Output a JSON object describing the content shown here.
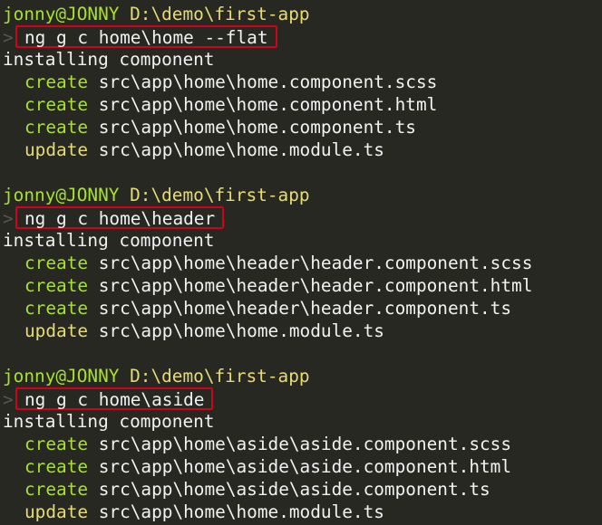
{
  "colors": {
    "background": "#272822",
    "user_host": "#a6e22e",
    "cwd": "#e6db74",
    "create": "#a6e22e",
    "update": "#e6db74",
    "text": "#f2f2f2",
    "highlight_box": "#d0021b"
  },
  "blocks": [
    {
      "user_host": "jonny@JONNY",
      "cwd": "D:\\demo\\first-app",
      "prompt_symbol": ">",
      "command": "ng g c home\\home --flat",
      "status": "installing component",
      "actions": [
        {
          "action": "create",
          "path": "src\\app\\home\\home.component.scss"
        },
        {
          "action": "create",
          "path": "src\\app\\home\\home.component.html"
        },
        {
          "action": "create",
          "path": "src\\app\\home\\home.component.ts"
        },
        {
          "action": "update",
          "path": "src\\app\\home\\home.module.ts"
        }
      ]
    },
    {
      "user_host": "jonny@JONNY",
      "cwd": "D:\\demo\\first-app",
      "prompt_symbol": ">",
      "command": "ng g c home\\header",
      "status": "installing component",
      "actions": [
        {
          "action": "create",
          "path": "src\\app\\home\\header\\header.component.scss"
        },
        {
          "action": "create",
          "path": "src\\app\\home\\header\\header.component.html"
        },
        {
          "action": "create",
          "path": "src\\app\\home\\header\\header.component.ts"
        },
        {
          "action": "update",
          "path": "src\\app\\home\\home.module.ts"
        }
      ]
    },
    {
      "user_host": "jonny@JONNY",
      "cwd": "D:\\demo\\first-app",
      "prompt_symbol": ">",
      "command": "ng g c home\\aside",
      "status": "installing component",
      "actions": [
        {
          "action": "create",
          "path": "src\\app\\home\\aside\\aside.component.scss"
        },
        {
          "action": "create",
          "path": "src\\app\\home\\aside\\aside.component.html"
        },
        {
          "action": "create",
          "path": "src\\app\\home\\aside\\aside.component.ts"
        },
        {
          "action": "update",
          "path": "src\\app\\home\\home.module.ts"
        }
      ]
    }
  ]
}
